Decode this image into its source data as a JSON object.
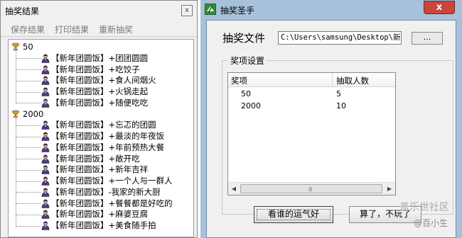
{
  "results_window": {
    "title": "抽奖结果",
    "close_label": "x",
    "toolbar": [
      "保存结果",
      "打印结果",
      "重新抽奖"
    ],
    "groups": [
      {
        "label": "50",
        "items": [
          "【新年团圆饭】+团团圆圆",
          "【新年团圆饭】+吃饺子",
          "【新年团圆饭】+食人间烟火",
          "【新年团圆饭】+火锅走起",
          "【新年团圆饭】+随便吃吃"
        ]
      },
      {
        "label": "2000",
        "items": [
          "【新年团圆饭】+忘忑的团圆",
          "【新年团圆饭】+最淡的年夜饭",
          "【新年团圆饭】+年前预热大餐",
          "【新年团圆饭】+敞开吃",
          "【新年团圆饭】+新年吉祥",
          "【新年团圆饭】+一个人与一群人",
          "【新年团圆饭】-我家的新大厨",
          "【新年团圆饭】+餐餐都是好吃的",
          "【新年团圆饭】+麻婆豆腐",
          "【新年团圆饭】+美食随手拍"
        ]
      }
    ]
  },
  "app_window": {
    "title": "抽奖圣手",
    "close_label": "x",
    "file_label": "抽奖文件",
    "file_path": "C:\\Users\\samsung\\Desktop\\新建",
    "browse_label": "...",
    "prize_group_label": "奖项设置",
    "columns": [
      "奖项",
      "抽取人数"
    ],
    "rows": [
      {
        "prize": "50",
        "count": "5"
      },
      {
        "prize": "2000",
        "count": "10"
      }
    ],
    "scroll_grip": "⁞⁞⁞",
    "lucky_button": "看谁的运气好",
    "quit_button": "算了，不玩了"
  },
  "watermark": {
    "site": "盖乐世社区",
    "user": "@百小生"
  },
  "colors": {
    "app_frame": "#a8c1da",
    "close_button": "#c9463d",
    "trophy": "#caa22a"
  },
  "icons": {
    "trophy": "trophy-icon",
    "user": "user-icon",
    "app_logo": "app-logo-icon"
  }
}
